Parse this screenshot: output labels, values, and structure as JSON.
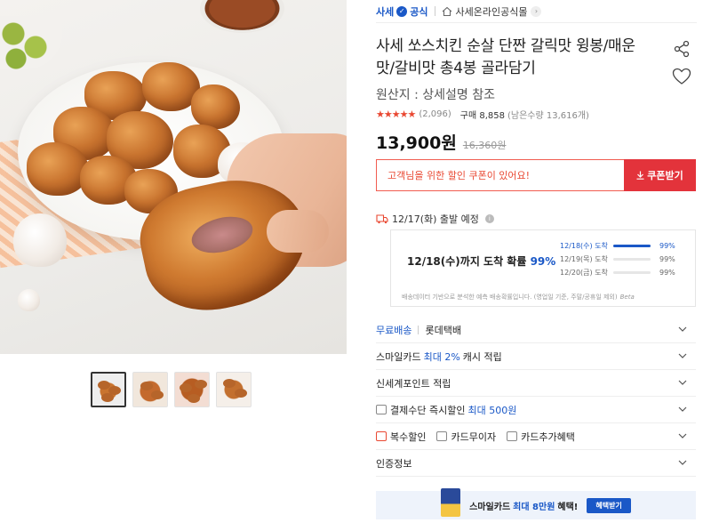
{
  "store": {
    "brand": "사세",
    "badge": "공식",
    "store_name": "사세온라인공식몰"
  },
  "product": {
    "title": "사세 쏘스치킨 순살 단짠 갈릭맛 윙봉/매운맛/갈비맛 총4봉 골라담기",
    "origin": "원산지 : 상세설명 참조",
    "stars": "★★★★★",
    "review_count": "(2,096)",
    "purchase_label": "구매 8,858",
    "stock": "(남은수량 13,616개)",
    "price": "13,900원",
    "original_price": "16,360원"
  },
  "coupon": {
    "message": "고객님을 위한 할인 쿠폰이 있어요!",
    "button": "쿠폰받기"
  },
  "shipping": {
    "departure": "12/17(화) 출발 예정"
  },
  "arrival": {
    "headline": "12/18(수)까지 도착 확률",
    "headline_pct": "99%",
    "rows": [
      {
        "date": "12/18(수) 도착",
        "pct": "99%",
        "fill": 1.0
      },
      {
        "date": "12/19(목) 도착",
        "pct": "99%",
        "fill": 0.0
      },
      {
        "date": "12/20(금) 도착",
        "pct": "99%",
        "fill": 0.0
      }
    ],
    "note": "배송데이터 기반으로 분석한 예측 배송확률입니다. (영업일 기준, 주말/공휴일 제외)",
    "beta": "Beta"
  },
  "options": {
    "free_shipping": "무료배송",
    "courier": "롯데택배",
    "smilecard_prefix": "스마일카드",
    "smilecard_highlight": "최대 2%",
    "smilecard_suffix": "캐시 적립",
    "shinsegae": "신세계포인트 적립",
    "payment_prefix": "결제수단 즉시할인",
    "payment_highlight": "최대 500원",
    "multi_discount": "복수할인",
    "interest_free": "카드무이자",
    "card_benefit": "카드추가혜택",
    "certification": "인증정보"
  },
  "banner": {
    "prefix": "스마일카드",
    "highlight": "최대 8만원",
    "suffix": "혜택!",
    "button": "혜택받기"
  },
  "colors": {
    "accent": "#1a58c7",
    "sale_red": "#e3333b"
  }
}
